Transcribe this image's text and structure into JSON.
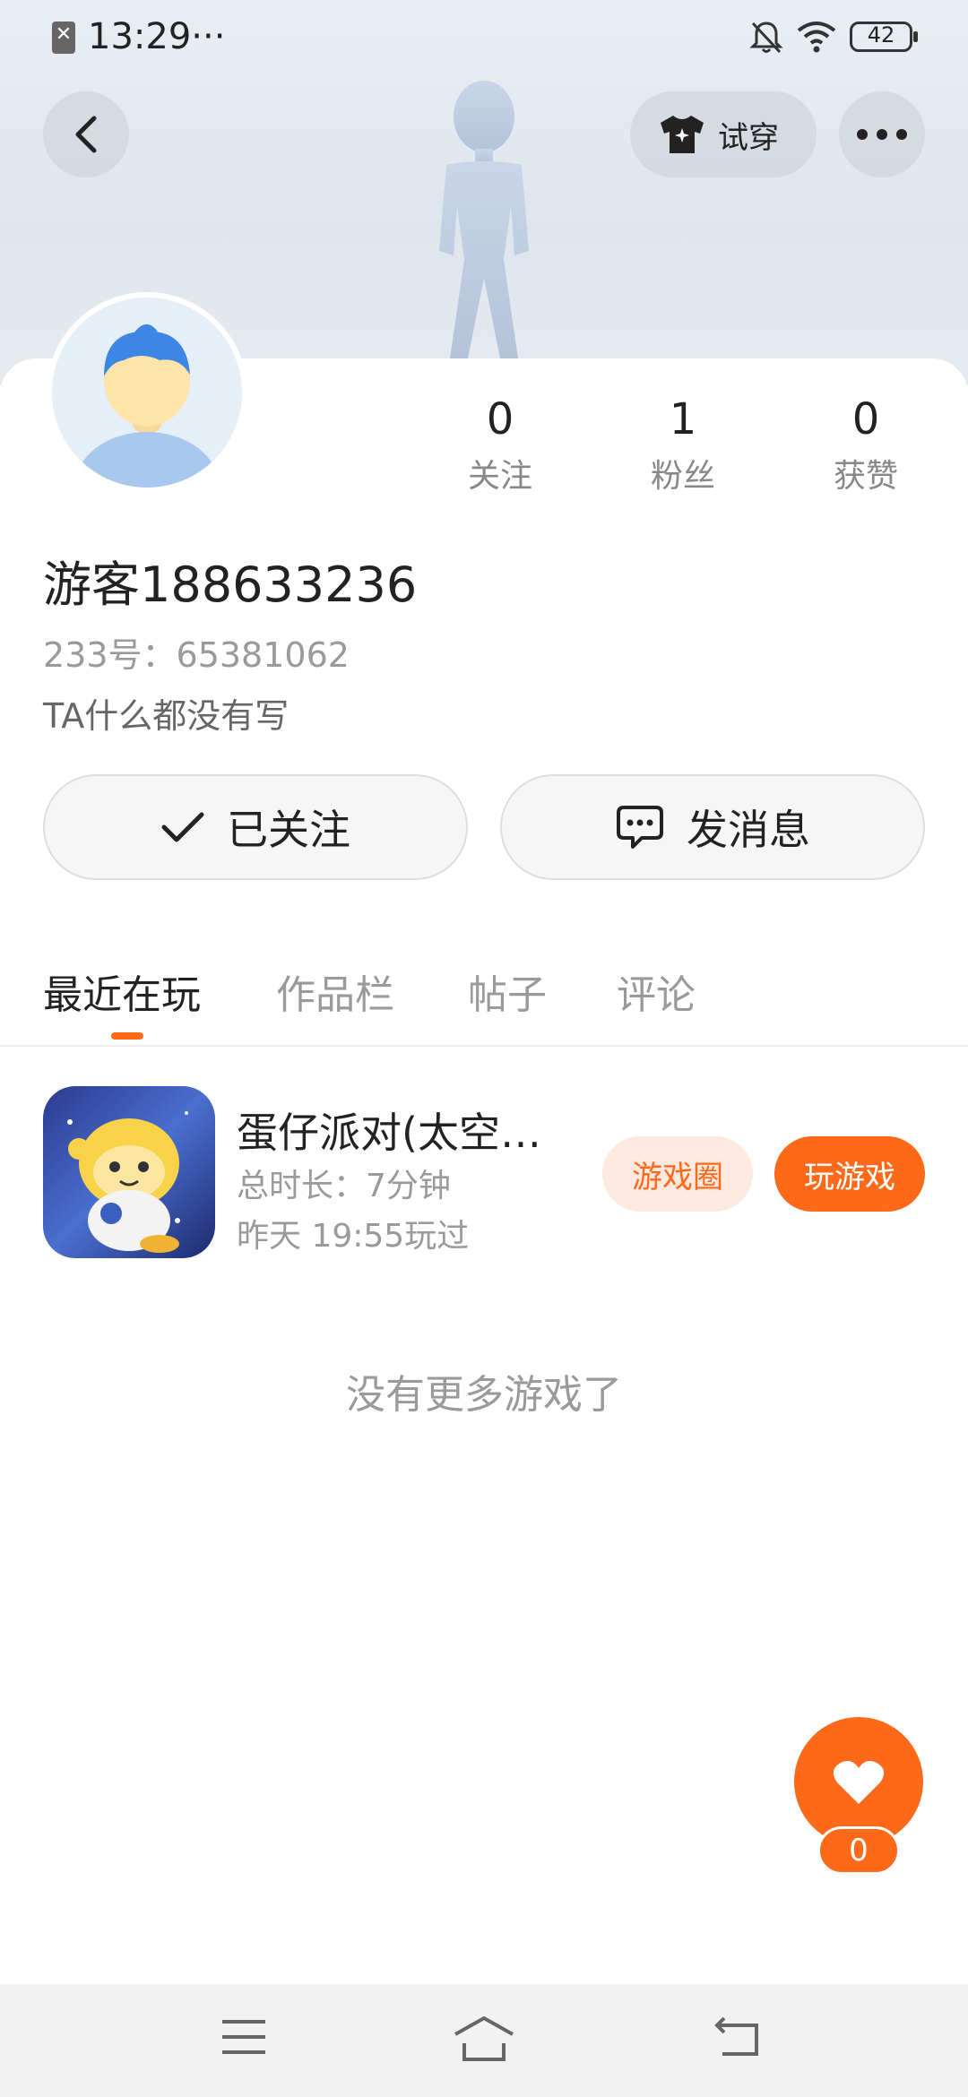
{
  "status_bar": {
    "time": "13:29",
    "dots": "···",
    "sim_glyph": "✕",
    "battery": "42"
  },
  "header": {
    "tryon_label": "试穿"
  },
  "profile": {
    "name": "游客188633236",
    "id_text": "233号：65381062",
    "bio": "TA什么都没有写",
    "stats": [
      {
        "value": "0",
        "label": "关注"
      },
      {
        "value": "1",
        "label": "粉丝"
      },
      {
        "value": "0",
        "label": "获赞"
      }
    ]
  },
  "actions": {
    "followed_label": "已关注",
    "message_label": "发消息"
  },
  "tabs": [
    {
      "label": "最近在玩",
      "active": true
    },
    {
      "label": "作品栏",
      "active": false
    },
    {
      "label": "帖子",
      "active": false
    },
    {
      "label": "评论",
      "active": false
    }
  ],
  "games": [
    {
      "title": "蛋仔派对(太空…",
      "duration": "总时长：7分钟",
      "last_played": "昨天 19:55玩过",
      "circle_label": "游戏圈",
      "play_label": "玩游戏"
    }
  ],
  "empty_text": "没有更多游戏了",
  "like_fab": {
    "count": "0"
  },
  "colors": {
    "accent": "#ff6a1a",
    "accent_light": "#fee9e0"
  }
}
